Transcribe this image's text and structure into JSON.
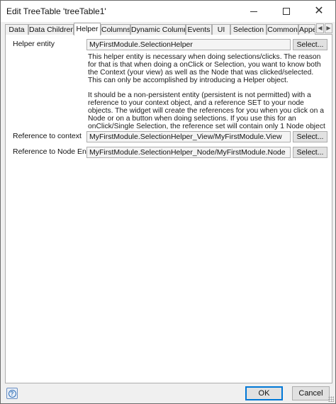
{
  "window": {
    "title": "Edit TreeTable 'treeTable1'",
    "minimize_icon": "minimize-icon",
    "maximize_icon": "maximize-icon",
    "close_icon": "close-icon",
    "close_glyph": "✕"
  },
  "tabs": [
    {
      "label": "Data",
      "active": false
    },
    {
      "label": "Data Children",
      "active": false
    },
    {
      "label": "Helper",
      "active": true
    },
    {
      "label": "Columns",
      "active": false
    },
    {
      "label": "Dynamic Columns",
      "active": false
    },
    {
      "label": "Events",
      "active": false
    },
    {
      "label": "UI",
      "active": false
    },
    {
      "label": "Selection",
      "active": false
    },
    {
      "label": "Common",
      "active": false
    },
    {
      "label": "Appe",
      "active": false
    }
  ],
  "tab_scroll": {
    "left_glyph": "◀",
    "right_glyph": "▶"
  },
  "helper": {
    "helper_entity_label": "Helper entity",
    "helper_entity_value": "MyFirstModule.SelectionHelper",
    "select_label": "Select...",
    "description_p1": "This helper entity is necessary when doing selections/clicks. The reason for that is that when doing a onClick or Selection, you want to know both the Context (your view) as well as the Node that was clicked/selected. This can only be accomplished by introducing a Helper object.",
    "description_p2": "It should be a non-persistent entity (persistent is not permitted) with a reference to your context object, and a reference SET to your node objects. The widget will create the references for you when you click on a Node or on a button when doing selections. If you use this for an onClick/Single Selection, the reference set will contain only 1 Node object",
    "reference_context_label": "Reference to context",
    "reference_context_value": "MyFirstModule.SelectionHelper_View/MyFirstModule.View",
    "reference_node_label": "Reference to Node Entity",
    "reference_node_value": "MyFirstModule.SelectionHelper_Node/MyFirstModule.Node"
  },
  "footer": {
    "help_icon": "help-icon",
    "help_glyph": "?",
    "ok_label": "OK",
    "cancel_label": "Cancel"
  },
  "colors": {
    "accent": "#0078d7",
    "panel_bg": "#ffffff",
    "dialog_bg": "#f0f0f0"
  }
}
